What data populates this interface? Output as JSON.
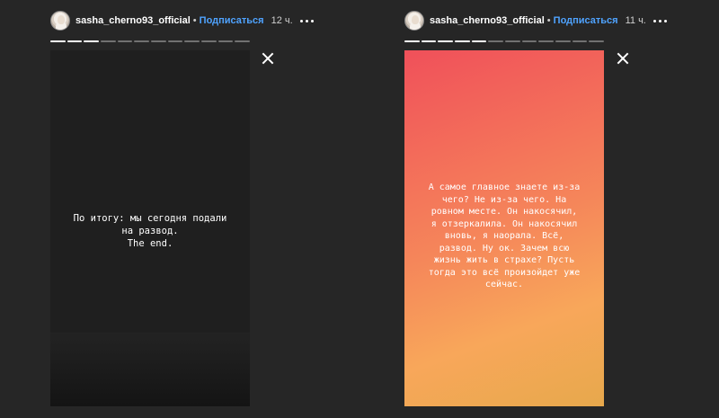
{
  "stories": [
    {
      "username": "sasha_cherno93_official",
      "separator": "•",
      "follow_label": "Подписаться",
      "time": "12 ч.",
      "progress": {
        "total_segments": 12,
        "completed_segments": 3
      },
      "text_lines": [
        "По итогу: мы сегодня подали",
        "на развод.",
        "The end."
      ]
    },
    {
      "username": "sasha_cherno93_official",
      "separator": "•",
      "follow_label": "Подписаться",
      "time": "11 ч.",
      "progress": {
        "total_segments": 12,
        "completed_segments": 5
      },
      "text_lines": [
        "А самое главное знаете из-за",
        "чего? Не из-за чего. На",
        "ровном месте. Он накосячил,",
        "я отзеркалила. Он накосячил",
        "вновь, я наорала. Всё,",
        "развод. Ну ок. Зачем всю",
        "жизнь жить в страхе? Пусть",
        "тогда это всё произойдет уже",
        "сейчас."
      ]
    }
  ],
  "icons": {
    "close": "close-icon",
    "more": "more-options-icon",
    "avatar": "avatar"
  },
  "colors": {
    "background": "#262626",
    "follow": "#4fa3ff",
    "gradient_start": "#f0505a",
    "gradient_end": "#e7a84c"
  }
}
